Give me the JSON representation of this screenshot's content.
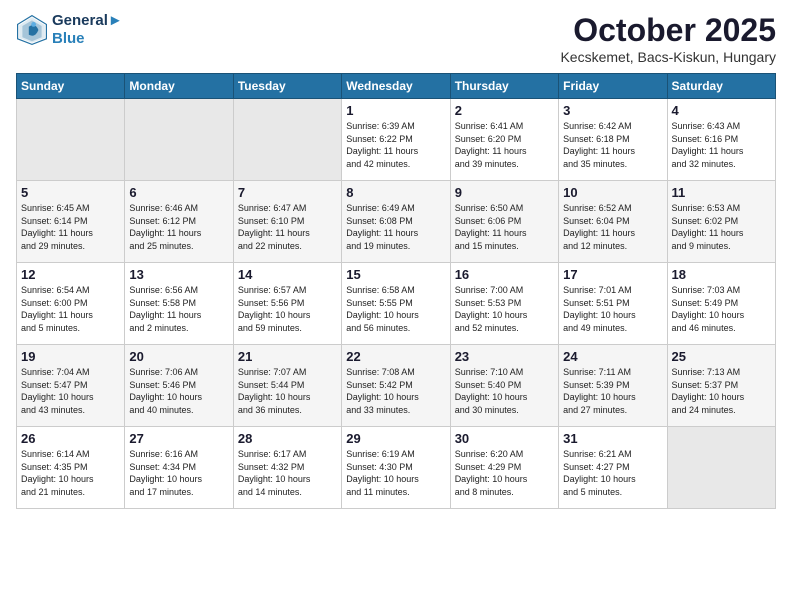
{
  "header": {
    "logo_line1": "General",
    "logo_line2": "Blue",
    "month": "October 2025",
    "location": "Kecskemet, Bacs-Kiskun, Hungary"
  },
  "weekdays": [
    "Sunday",
    "Monday",
    "Tuesday",
    "Wednesday",
    "Thursday",
    "Friday",
    "Saturday"
  ],
  "weeks": [
    [
      {
        "day": "",
        "info": ""
      },
      {
        "day": "",
        "info": ""
      },
      {
        "day": "",
        "info": ""
      },
      {
        "day": "1",
        "info": "Sunrise: 6:39 AM\nSunset: 6:22 PM\nDaylight: 11 hours\nand 42 minutes."
      },
      {
        "day": "2",
        "info": "Sunrise: 6:41 AM\nSunset: 6:20 PM\nDaylight: 11 hours\nand 39 minutes."
      },
      {
        "day": "3",
        "info": "Sunrise: 6:42 AM\nSunset: 6:18 PM\nDaylight: 11 hours\nand 35 minutes."
      },
      {
        "day": "4",
        "info": "Sunrise: 6:43 AM\nSunset: 6:16 PM\nDaylight: 11 hours\nand 32 minutes."
      }
    ],
    [
      {
        "day": "5",
        "info": "Sunrise: 6:45 AM\nSunset: 6:14 PM\nDaylight: 11 hours\nand 29 minutes."
      },
      {
        "day": "6",
        "info": "Sunrise: 6:46 AM\nSunset: 6:12 PM\nDaylight: 11 hours\nand 25 minutes."
      },
      {
        "day": "7",
        "info": "Sunrise: 6:47 AM\nSunset: 6:10 PM\nDaylight: 11 hours\nand 22 minutes."
      },
      {
        "day": "8",
        "info": "Sunrise: 6:49 AM\nSunset: 6:08 PM\nDaylight: 11 hours\nand 19 minutes."
      },
      {
        "day": "9",
        "info": "Sunrise: 6:50 AM\nSunset: 6:06 PM\nDaylight: 11 hours\nand 15 minutes."
      },
      {
        "day": "10",
        "info": "Sunrise: 6:52 AM\nSunset: 6:04 PM\nDaylight: 11 hours\nand 12 minutes."
      },
      {
        "day": "11",
        "info": "Sunrise: 6:53 AM\nSunset: 6:02 PM\nDaylight: 11 hours\nand 9 minutes."
      }
    ],
    [
      {
        "day": "12",
        "info": "Sunrise: 6:54 AM\nSunset: 6:00 PM\nDaylight: 11 hours\nand 5 minutes."
      },
      {
        "day": "13",
        "info": "Sunrise: 6:56 AM\nSunset: 5:58 PM\nDaylight: 11 hours\nand 2 minutes."
      },
      {
        "day": "14",
        "info": "Sunrise: 6:57 AM\nSunset: 5:56 PM\nDaylight: 10 hours\nand 59 minutes."
      },
      {
        "day": "15",
        "info": "Sunrise: 6:58 AM\nSunset: 5:55 PM\nDaylight: 10 hours\nand 56 minutes."
      },
      {
        "day": "16",
        "info": "Sunrise: 7:00 AM\nSunset: 5:53 PM\nDaylight: 10 hours\nand 52 minutes."
      },
      {
        "day": "17",
        "info": "Sunrise: 7:01 AM\nSunset: 5:51 PM\nDaylight: 10 hours\nand 49 minutes."
      },
      {
        "day": "18",
        "info": "Sunrise: 7:03 AM\nSunset: 5:49 PM\nDaylight: 10 hours\nand 46 minutes."
      }
    ],
    [
      {
        "day": "19",
        "info": "Sunrise: 7:04 AM\nSunset: 5:47 PM\nDaylight: 10 hours\nand 43 minutes."
      },
      {
        "day": "20",
        "info": "Sunrise: 7:06 AM\nSunset: 5:46 PM\nDaylight: 10 hours\nand 40 minutes."
      },
      {
        "day": "21",
        "info": "Sunrise: 7:07 AM\nSunset: 5:44 PM\nDaylight: 10 hours\nand 36 minutes."
      },
      {
        "day": "22",
        "info": "Sunrise: 7:08 AM\nSunset: 5:42 PM\nDaylight: 10 hours\nand 33 minutes."
      },
      {
        "day": "23",
        "info": "Sunrise: 7:10 AM\nSunset: 5:40 PM\nDaylight: 10 hours\nand 30 minutes."
      },
      {
        "day": "24",
        "info": "Sunrise: 7:11 AM\nSunset: 5:39 PM\nDaylight: 10 hours\nand 27 minutes."
      },
      {
        "day": "25",
        "info": "Sunrise: 7:13 AM\nSunset: 5:37 PM\nDaylight: 10 hours\nand 24 minutes."
      }
    ],
    [
      {
        "day": "26",
        "info": "Sunrise: 6:14 AM\nSunset: 4:35 PM\nDaylight: 10 hours\nand 21 minutes."
      },
      {
        "day": "27",
        "info": "Sunrise: 6:16 AM\nSunset: 4:34 PM\nDaylight: 10 hours\nand 17 minutes."
      },
      {
        "day": "28",
        "info": "Sunrise: 6:17 AM\nSunset: 4:32 PM\nDaylight: 10 hours\nand 14 minutes."
      },
      {
        "day": "29",
        "info": "Sunrise: 6:19 AM\nSunset: 4:30 PM\nDaylight: 10 hours\nand 11 minutes."
      },
      {
        "day": "30",
        "info": "Sunrise: 6:20 AM\nSunset: 4:29 PM\nDaylight: 10 hours\nand 8 minutes."
      },
      {
        "day": "31",
        "info": "Sunrise: 6:21 AM\nSunset: 4:27 PM\nDaylight: 10 hours\nand 5 minutes."
      },
      {
        "day": "",
        "info": ""
      }
    ]
  ]
}
